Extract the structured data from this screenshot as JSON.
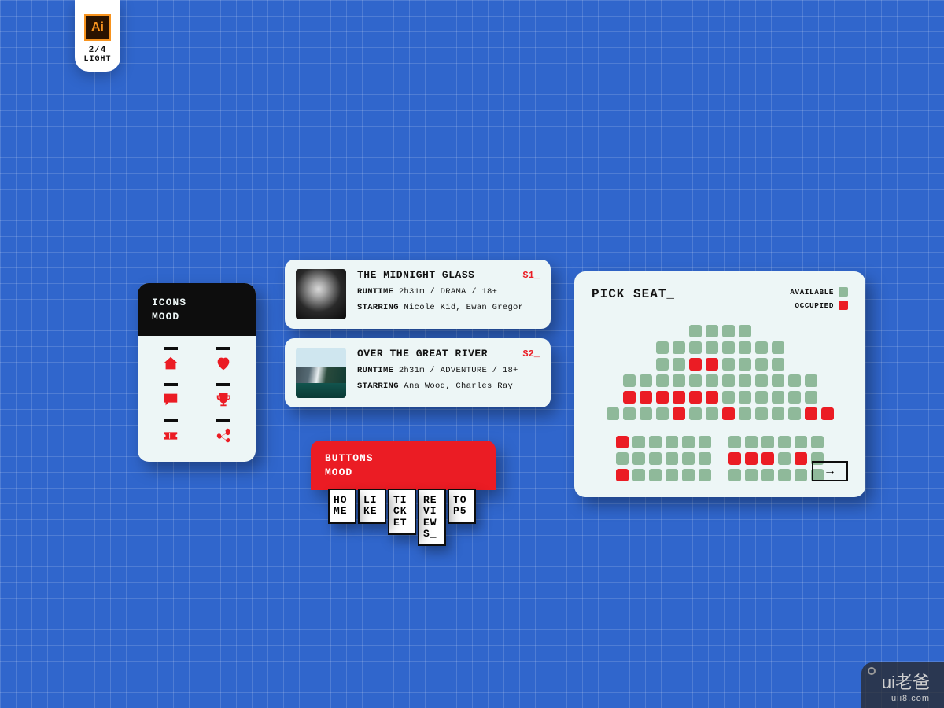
{
  "badge": {
    "logo": "Ai",
    "count": "2/4",
    "label": "LIGHT"
  },
  "icons_card": {
    "title_l1": "ICONS",
    "title_l2": "MOOD",
    "icons": [
      "home",
      "heart",
      "star-badge",
      "trophy",
      "ticket",
      "share"
    ]
  },
  "movies": [
    {
      "title": "THE MIDNIGHT GLASS",
      "code": "S1_",
      "runtime_label": "RUNTIME",
      "meta": "2h31m / DRAMA / 18+",
      "starring_label": "STARRING",
      "starring": "Nicole Kid, Ewan Gregor"
    },
    {
      "title": "OVER THE GREAT RIVER",
      "code": "S2_",
      "runtime_label": "RUNTIME",
      "meta": "2h31m / ADVENTURE / 18+",
      "starring_label": "STARRING",
      "starring": "Ana Wood, Charles Ray"
    }
  ],
  "buttons_card": {
    "title_l1": "BUTTONS",
    "title_l2": "MOOD",
    "tabs": [
      "HOME",
      "LIKE",
      "TICKET",
      "REVIEWS_",
      "TOP5"
    ]
  },
  "seat_card": {
    "title": "PICK SEAT_",
    "legend_available": "AVAILABLE",
    "legend_occupied": "OCCUPIED",
    "next_icon": "→",
    "rows_top": [
      "aaaa",
      "aaaaaaaa",
      "aaooaaaa",
      "aaaaaaaaaaaa",
      "ooooooaaaaaa",
      "aaaaoaaoaaaaoo"
    ],
    "rows_bottom_left": [
      "oaaaaa",
      "aaaaaa",
      "oaaaaa"
    ],
    "rows_bottom_right": [
      "aaaaaa",
      "oooaoa",
      "aaaaaa"
    ]
  },
  "watermark": {
    "main": "ui老爸",
    "sub": "uii8.com"
  },
  "colors": {
    "red": "#eb1c24",
    "green": "#8fb99a",
    "dark": "#0d0d0d",
    "panel": "#edf6f6"
  }
}
